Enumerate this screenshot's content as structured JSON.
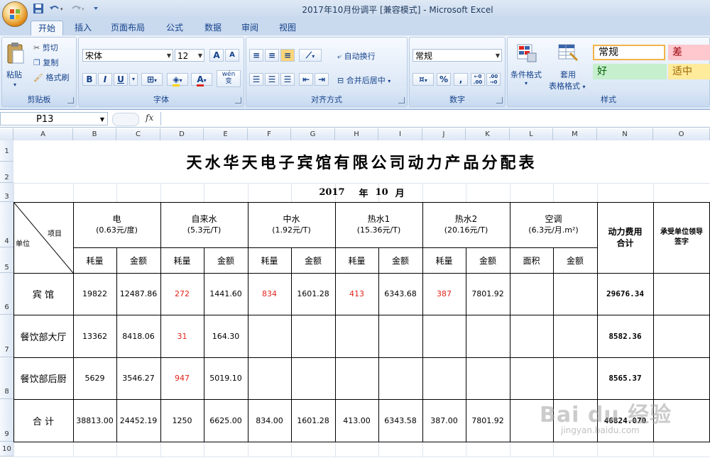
{
  "window": {
    "title": "2017年10月份调平  [兼容模式] - Microsoft Excel"
  },
  "tabs": [
    "开始",
    "插入",
    "页面布局",
    "公式",
    "数据",
    "审阅",
    "视图"
  ],
  "ribbon": {
    "clipboard": {
      "paste": "粘贴",
      "cut": "剪切",
      "copy": "复制",
      "format_painter": "格式刷",
      "label": "剪贴板"
    },
    "font": {
      "name": "宋体",
      "size": "12",
      "grow": "A",
      "shrink": "A",
      "bold": "B",
      "italic": "I",
      "underline": "U",
      "wen": "wén",
      "wen2": "变",
      "label": "字体"
    },
    "align": {
      "wrap": "自动换行",
      "merge": "合并后居中",
      "label": "对齐方式"
    },
    "number": {
      "format": "常规",
      "percent": "%",
      "comma": ",",
      "inc": "+.0\n.00",
      "dec": ".00\n+.0",
      "label": "数字"
    },
    "styles": {
      "cond": "条件格式",
      "table1": "套用",
      "table2": "表格格式",
      "normal": "常规",
      "bad": "差",
      "good": "好",
      "neutral": "适中",
      "label": "样式"
    }
  },
  "formula_bar": {
    "name_box": "P13",
    "fx": "fx",
    "content": ""
  },
  "columns": [
    "A",
    "B",
    "C",
    "D",
    "E",
    "F",
    "G",
    "H",
    "I",
    "J",
    "K",
    "L",
    "M",
    "N",
    "O"
  ],
  "rows": [
    "1",
    "2",
    "3",
    "4",
    "5",
    "6",
    "7",
    "8",
    "9",
    "10"
  ],
  "sheet": {
    "title": "天水华天电子宾馆有限公司动力产品分配表",
    "period_year": "2017",
    "period_mid": "年",
    "period_month": "10",
    "period_end": "月",
    "diag_item": "项目",
    "diag_unit": "单位",
    "groups": [
      {
        "name": "电",
        "price": "(0.63元/度)"
      },
      {
        "name": "自来水",
        "price": "(5.3元/T)"
      },
      {
        "name": "中水",
        "price": "(1.92元/T)"
      },
      {
        "name": "热水1",
        "price": "(15.36元/T)"
      },
      {
        "name": "热水2",
        "price": "(20.16元/T)"
      },
      {
        "name": "空调",
        "price": "(6.3元/月.m²)"
      }
    ],
    "total_header": "动力费用合计",
    "sign_header": "承受单位领导签字",
    "sub": [
      "耗量",
      "金额",
      "耗量",
      "金额",
      "耗量",
      "金额",
      "耗量",
      "金额",
      "耗量",
      "金额",
      "面积",
      "金额"
    ],
    "data_rows": [
      {
        "unit": "宾 馆",
        "cells": [
          "19822",
          "12487.86",
          "272",
          "1441.60",
          "834",
          "1601.28",
          "413",
          "6343.68",
          "387",
          "7801.92",
          "",
          ""
        ],
        "total": "29676.34"
      },
      {
        "unit": "餐饮部大厅",
        "cells": [
          "13362",
          "8418.06",
          "31",
          "164.30",
          "",
          "",
          "",
          "",
          "",
          "",
          "",
          ""
        ],
        "total": "8582.36"
      },
      {
        "unit": "餐饮部后厨",
        "cells": [
          "5629",
          "3546.27",
          "947",
          "5019.10",
          "",
          "",
          "",
          "",
          "",
          "",
          "",
          ""
        ],
        "total": "8565.37"
      },
      {
        "unit": "合 计",
        "cells": [
          "38813.00",
          "24452.19",
          "1250",
          "6625.00",
          "834.00",
          "1601.28",
          "413.00",
          "6343.58",
          "387.00",
          "7801.92",
          "",
          ""
        ],
        "total": "46824.070"
      }
    ],
    "red_cells": [
      [
        0,
        2
      ],
      [
        0,
        4
      ],
      [
        0,
        6
      ],
      [
        0,
        8
      ],
      [
        1,
        2
      ],
      [
        2,
        2
      ]
    ]
  },
  "watermark": {
    "brand": "Bai du 经验",
    "url": "jingyan.baidu.com"
  }
}
